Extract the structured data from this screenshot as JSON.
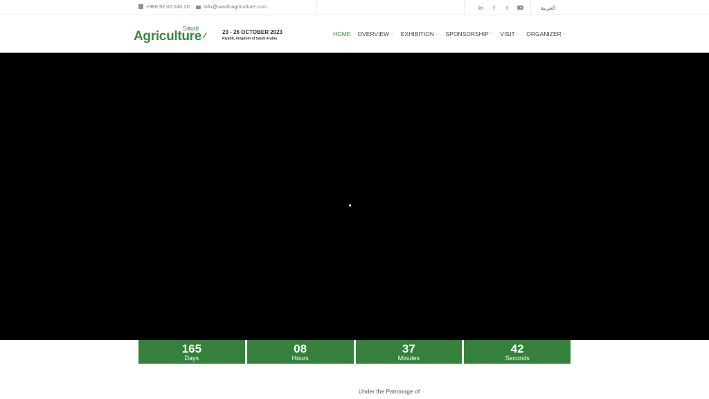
{
  "topbar": {
    "phone": "+966 92 00 240 20",
    "email": "info@saudi-agriculture.com",
    "social": [
      "in",
      "f",
      "t",
      "yt"
    ],
    "language": "العربية"
  },
  "logo": {
    "brand_small": "Saudi",
    "brand": "Agriculture",
    "dates": "23 - 26 OCTOBER 2023",
    "location": "Riyadh, Kingdom of Saudi Arabia"
  },
  "nav": {
    "items": [
      {
        "label": "HOME",
        "active": true
      },
      {
        "label": "OVERVIEW",
        "active": false
      },
      {
        "label": "EXHIBITION",
        "active": false
      },
      {
        "label": "SPONSORSHIP",
        "active": false
      },
      {
        "label": "VISIT",
        "active": false
      },
      {
        "label": "ORGANIZER",
        "active": false
      }
    ]
  },
  "countdown": {
    "days": {
      "value": "165",
      "label": "Days"
    },
    "hours": {
      "value": "08",
      "label": "Hours"
    },
    "minutes": {
      "value": "37",
      "label": "Minutes"
    },
    "seconds": {
      "value": "42",
      "label": "Seconds"
    }
  },
  "patronage": "Under the Patronage of",
  "colors": {
    "brand_green": "#35813b",
    "hero_bg": "#000000"
  }
}
